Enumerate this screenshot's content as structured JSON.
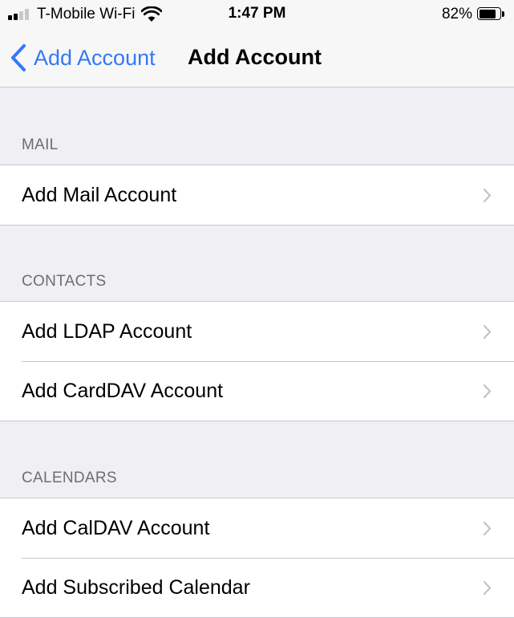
{
  "status_bar": {
    "carrier": "T-Mobile Wi-Fi",
    "time": "1:47 PM",
    "battery_percent_label": "82%",
    "battery_level": 0.82,
    "signal_bars_active": 2,
    "signal_bars_total": 4
  },
  "nav": {
    "back_label": "Add Account",
    "back_icon": "chevron-left-icon",
    "title": "Add Account"
  },
  "colors": {
    "accent": "#3478f6",
    "background": "#efeff4",
    "separator": "#c8c7cc",
    "section_header": "#6d6d72",
    "chevron": "#c4c4c7"
  },
  "sections": [
    {
      "header": "MAIL",
      "items": [
        {
          "label": "Add Mail Account"
        }
      ]
    },
    {
      "header": "CONTACTS",
      "items": [
        {
          "label": "Add LDAP Account"
        },
        {
          "label": "Add CardDAV Account"
        }
      ]
    },
    {
      "header": "CALENDARS",
      "items": [
        {
          "label": "Add CalDAV Account"
        },
        {
          "label": "Add Subscribed Calendar"
        }
      ]
    }
  ]
}
